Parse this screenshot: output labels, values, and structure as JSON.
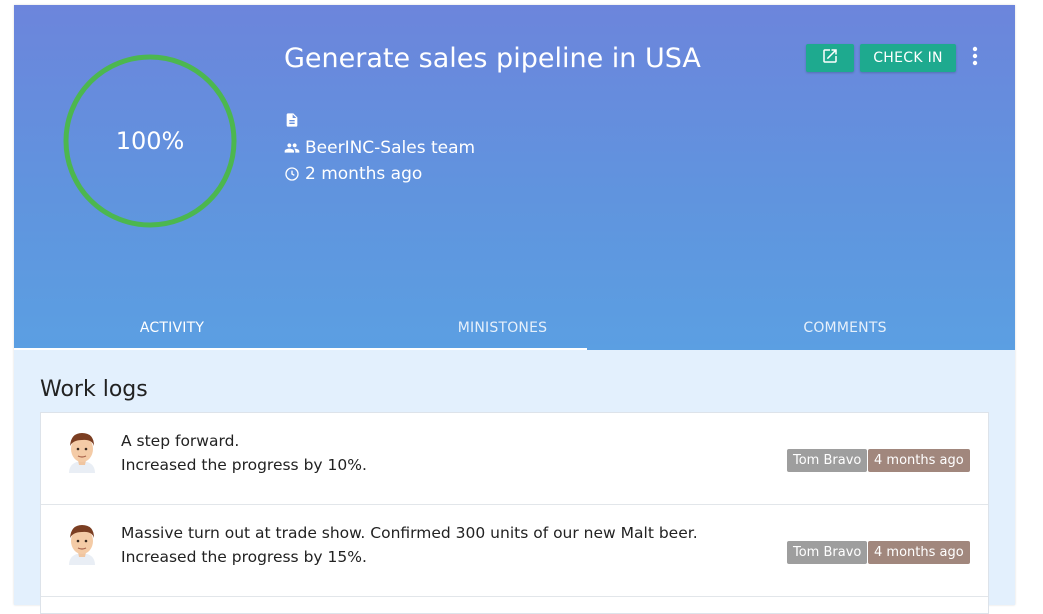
{
  "goal": {
    "title": "Generate sales pipeline in USA",
    "progress_label": "100%",
    "progress_value": 1.0,
    "team": "BeerINC-Sales team",
    "updated": "2 months ago"
  },
  "actions": {
    "open_icon": "open-in-new-icon",
    "check_in_label": "CHECK IN",
    "more_icon": "more-vert-icon"
  },
  "tabs": [
    {
      "label": "ACTIVITY",
      "active": true
    },
    {
      "label": "MINISTONES",
      "active": false
    },
    {
      "label": "COMMENTS",
      "active": false
    }
  ],
  "worklogs": {
    "title": "Work logs",
    "items": [
      {
        "title": "A step forward.",
        "detail": "Increased the progress by 10%.",
        "user": "Tom Bravo",
        "time": "4 months ago"
      },
      {
        "title": "Massive turn out at trade show. Confirmed 300 units of our new Malt beer.",
        "detail": "Increased the progress by 15%.",
        "user": "Tom Bravo",
        "time": "4 months ago"
      }
    ]
  },
  "colors": {
    "progress_ring": "#4cb74f",
    "action_button": "#1eaa8f",
    "user_badge": "#9e9e9e",
    "time_badge": "#a1877d"
  }
}
